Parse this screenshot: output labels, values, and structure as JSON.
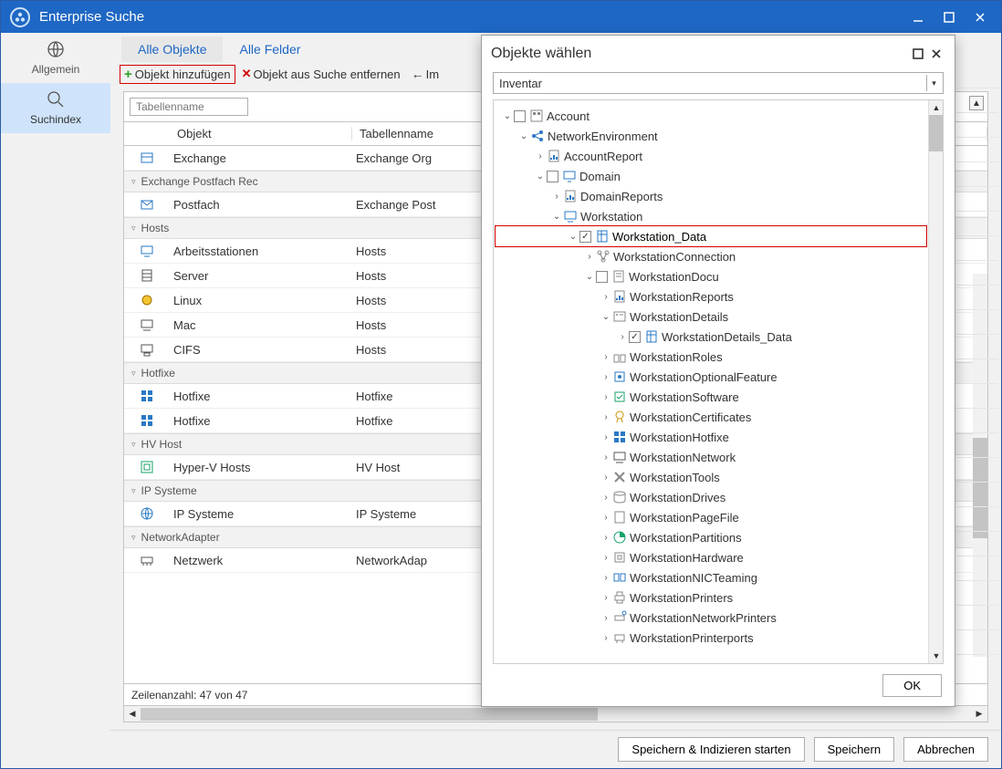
{
  "window": {
    "title": "Enterprise Suche"
  },
  "sidebar": {
    "items": [
      {
        "label": "Allgemein"
      },
      {
        "label": "Suchindex"
      }
    ]
  },
  "tabs": [
    {
      "label": "Alle Objekte",
      "active": true
    },
    {
      "label": "Alle Felder",
      "active": false
    }
  ],
  "toolbar": {
    "add": "Objekt hinzufügen",
    "remove": "Objekt aus Suche entfernen",
    "import": "Im"
  },
  "filter": {
    "placeholder": "Tabellenname"
  },
  "columns": {
    "object": "Objekt",
    "table": "Tabellenname"
  },
  "table_groups": [
    {
      "name": "",
      "rows": [
        {
          "obj": "Exchange",
          "tab": "Exchange Org",
          "icon": "exchange"
        }
      ]
    },
    {
      "name": "Exchange Postfach Rec",
      "rows": [
        {
          "obj": "Postfach",
          "tab": "Exchange Post",
          "icon": "mailbox"
        }
      ]
    },
    {
      "name": "Hosts",
      "rows": [
        {
          "obj": "Arbeitsstationen",
          "tab": "Hosts",
          "icon": "workstation"
        },
        {
          "obj": "Server",
          "tab": "Hosts",
          "icon": "server"
        },
        {
          "obj": "Linux",
          "tab": "Hosts",
          "icon": "linux"
        },
        {
          "obj": "Mac",
          "tab": "Hosts",
          "icon": "mac"
        },
        {
          "obj": "CIFS",
          "tab": "Hosts",
          "icon": "cifs"
        }
      ]
    },
    {
      "name": "Hotfixe",
      "rows": [
        {
          "obj": "Hotfixe",
          "tab": "Hotfixe",
          "icon": "win"
        },
        {
          "obj": "Hotfixe",
          "tab": "Hotfixe",
          "icon": "win"
        }
      ]
    },
    {
      "name": "HV Host",
      "rows": [
        {
          "obj": "Hyper-V Hosts",
          "tab": "HV Host",
          "icon": "hyperv"
        }
      ]
    },
    {
      "name": "IP Systeme",
      "rows": [
        {
          "obj": "IP Systeme",
          "tab": "IP Systeme",
          "icon": "globe"
        }
      ]
    },
    {
      "name": "NetworkAdapter",
      "rows": [
        {
          "obj": "Netzwerk",
          "tab": "NetworkAdap",
          "icon": "nic"
        }
      ]
    }
  ],
  "status": "Zeilenanzahl: 47 von 47",
  "buttons": {
    "save_index": "Speichern & Indizieren starten",
    "save": "Speichern",
    "cancel": "Abbrechen"
  },
  "dialog": {
    "title": "Objekte wählen",
    "combo": "Inventar",
    "ok": "OK",
    "tree": [
      {
        "d": 0,
        "exp": "v",
        "cb": false,
        "checked": false,
        "icon": "account",
        "label": "Account"
      },
      {
        "d": 1,
        "exp": "v",
        "cb": null,
        "icon": "netenv",
        "label": "NetworkEnvironment"
      },
      {
        "d": 2,
        "exp": ">",
        "cb": null,
        "icon": "report",
        "label": "AccountReport"
      },
      {
        "d": 2,
        "exp": "v",
        "cb": false,
        "checked": false,
        "icon": "domain",
        "label": "Domain"
      },
      {
        "d": 3,
        "exp": ">",
        "cb": null,
        "icon": "report",
        "label": "DomainReports"
      },
      {
        "d": 3,
        "exp": "v",
        "cb": null,
        "icon": "workstation",
        "label": "Workstation"
      },
      {
        "d": 4,
        "exp": "v",
        "cb": true,
        "checked": true,
        "icon": "data",
        "label": "Workstation_Data",
        "highlight": true
      },
      {
        "d": 5,
        "exp": ">",
        "cb": null,
        "icon": "conn",
        "label": "WorkstationConnection"
      },
      {
        "d": 5,
        "exp": "v",
        "cb": false,
        "checked": false,
        "icon": "docu",
        "label": "WorkstationDocu"
      },
      {
        "d": 6,
        "exp": ">",
        "cb": null,
        "icon": "report",
        "label": "WorkstationReports"
      },
      {
        "d": 6,
        "exp": "v",
        "cb": null,
        "icon": "details",
        "label": "WorkstationDetails"
      },
      {
        "d": 7,
        "exp": ">",
        "cb": true,
        "checked": true,
        "icon": "data",
        "label": "WorkstationDetails_Data"
      },
      {
        "d": 6,
        "exp": ">",
        "cb": null,
        "icon": "roles",
        "label": "WorkstationRoles"
      },
      {
        "d": 6,
        "exp": ">",
        "cb": null,
        "icon": "feature",
        "label": "WorkstationOptionalFeature"
      },
      {
        "d": 6,
        "exp": ">",
        "cb": null,
        "icon": "software",
        "label": "WorkstationSoftware"
      },
      {
        "d": 6,
        "exp": ">",
        "cb": null,
        "icon": "cert",
        "label": "WorkstationCertificates"
      },
      {
        "d": 6,
        "exp": ">",
        "cb": null,
        "icon": "win",
        "label": "WorkstationHotfixe"
      },
      {
        "d": 6,
        "exp": ">",
        "cb": null,
        "icon": "net",
        "label": "WorkstationNetwork"
      },
      {
        "d": 6,
        "exp": ">",
        "cb": null,
        "icon": "tools",
        "label": "WorkstationTools"
      },
      {
        "d": 6,
        "exp": ">",
        "cb": null,
        "icon": "drives",
        "label": "WorkstationDrives"
      },
      {
        "d": 6,
        "exp": ">",
        "cb": null,
        "icon": "page",
        "label": "WorkstationPageFile"
      },
      {
        "d": 6,
        "exp": ">",
        "cb": null,
        "icon": "pie",
        "label": "WorkstationPartitions"
      },
      {
        "d": 6,
        "exp": ">",
        "cb": null,
        "icon": "hw",
        "label": "WorkstationHardware"
      },
      {
        "d": 6,
        "exp": ">",
        "cb": null,
        "icon": "nicteam",
        "label": "WorkstationNICTeaming"
      },
      {
        "d": 6,
        "exp": ">",
        "cb": null,
        "icon": "printer",
        "label": "WorkstationPrinters"
      },
      {
        "d": 6,
        "exp": ">",
        "cb": null,
        "icon": "netprinter",
        "label": "WorkstationNetworkPrinters"
      },
      {
        "d": 6,
        "exp": ">",
        "cb": null,
        "icon": "port",
        "label": "WorkstationPrinterports"
      }
    ]
  }
}
